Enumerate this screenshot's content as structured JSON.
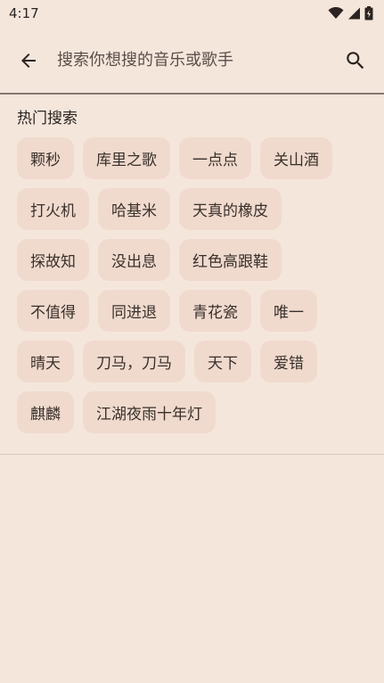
{
  "status_bar": {
    "time": "4:17"
  },
  "search": {
    "placeholder": "搜索你想搜的音乐或歌手"
  },
  "hot_search": {
    "title": "热门搜索",
    "rows": [
      [
        "颗秒",
        "库里之歌",
        "一点点",
        "关山酒"
      ],
      [
        "打火机",
        "哈基米",
        "天真的橡皮"
      ],
      [
        "探故知",
        "没出息",
        "红色高跟鞋"
      ],
      [
        "不值得",
        "同进退",
        "青花瓷",
        "唯一"
      ],
      [
        "晴天",
        "刀马，刀马",
        "天下",
        "爱错"
      ],
      [
        "麒麟",
        "江湖夜雨十年灯"
      ]
    ]
  }
}
